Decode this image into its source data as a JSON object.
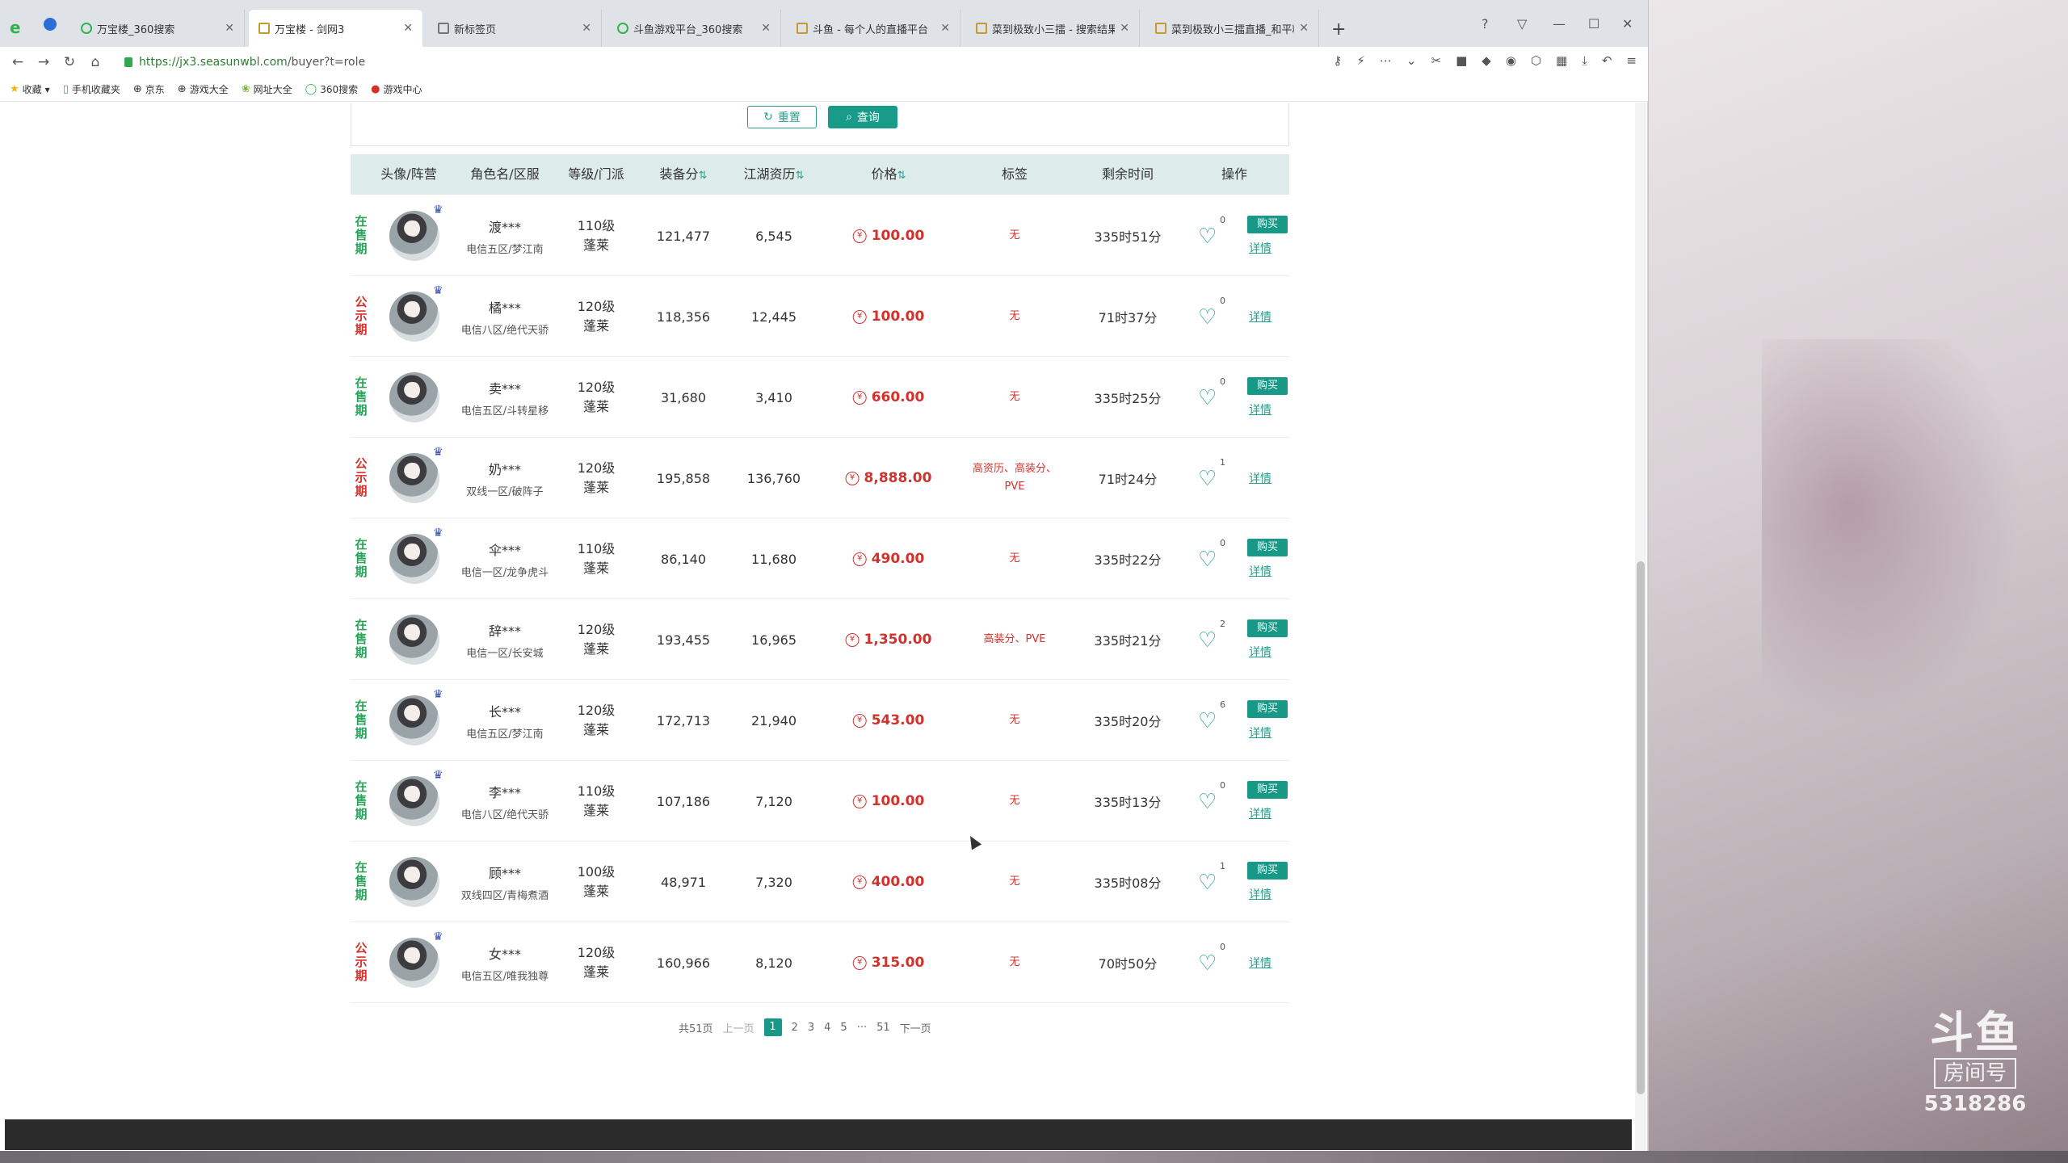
{
  "browser": {
    "tabs": [
      {
        "title": "万宝楼_360搜索"
      },
      {
        "title": "万宝楼 - 剑网3"
      },
      {
        "title": "新标签页"
      },
      {
        "title": "斗鱼游戏平台_360搜索"
      },
      {
        "title": "斗鱼 - 每个人的直播平台"
      },
      {
        "title": "菜到极致小三擂 - 搜索结果 -"
      },
      {
        "title": "菜到极致小三擂直播_和平精英"
      }
    ],
    "new_tab": "+",
    "url_host": "https://jx3.seasunwbl.com",
    "url_path": "/buyer?t=role",
    "bookmarks": [
      "收藏",
      "手机收藏夹",
      "京东",
      "游戏大全",
      "网址大全",
      "360搜索",
      "游戏中心"
    ]
  },
  "filter": {
    "reset_label": "重置",
    "query_label": "查询"
  },
  "table": {
    "headers": {
      "avatar": "头像/阵营",
      "role": "角色名/区服",
      "level": "等级/门派",
      "equip": "装备分",
      "jianghu": "江湖资历",
      "price": "价格",
      "tags": "标签",
      "remaining": "剩余时间",
      "action": "操作"
    },
    "sort_icon": "⇅",
    "buy_label": "购买",
    "detail_label": "详情",
    "coin_icon": "¥",
    "rows": [
      {
        "status": "在售期",
        "status_color": "#2aa35a",
        "badge": "♛",
        "name": "渡***",
        "server": "电信五区/梦江南",
        "level": "110级",
        "school": "蓬莱",
        "equip": "121,477",
        "jianghu": "6,545",
        "price": "100.00",
        "tags": "无",
        "remaining": "335时51分",
        "favs": "0",
        "buy": true
      },
      {
        "status": "公示期",
        "status_color": "#d3312c",
        "badge": "♛",
        "name": "橘***",
        "server": "电信八区/绝代天骄",
        "level": "120级",
        "school": "蓬莱",
        "equip": "118,356",
        "jianghu": "12,445",
        "price": "100.00",
        "tags": "无",
        "remaining": "71时37分",
        "favs": "0",
        "buy": false
      },
      {
        "status": "在售期",
        "status_color": "#2aa35a",
        "badge": "",
        "name": "卖***",
        "server": "电信五区/斗转星移",
        "level": "120级",
        "school": "蓬莱",
        "equip": "31,680",
        "jianghu": "3,410",
        "price": "660.00",
        "tags": "无",
        "remaining": "335时25分",
        "favs": "0",
        "buy": true
      },
      {
        "status": "公示期",
        "status_color": "#d3312c",
        "badge": "♛",
        "name": "奶***",
        "server": "双线一区/破阵子",
        "level": "120级",
        "school": "蓬莱",
        "equip": "195,858",
        "jianghu": "136,760",
        "price": "8,888.00",
        "tags": "高资历、高装分、PVE",
        "remaining": "71时24分",
        "favs": "1",
        "buy": false
      },
      {
        "status": "在售期",
        "status_color": "#2aa35a",
        "badge": "♛",
        "name": "伞***",
        "server": "电信一区/龙争虎斗",
        "level": "110级",
        "school": "蓬莱",
        "equip": "86,140",
        "jianghu": "11,680",
        "price": "490.00",
        "tags": "无",
        "remaining": "335时22分",
        "favs": "0",
        "buy": true
      },
      {
        "status": "在售期",
        "status_color": "#2aa35a",
        "badge": "",
        "name": "辞***",
        "server": "电信一区/长安城",
        "level": "120级",
        "school": "蓬莱",
        "equip": "193,455",
        "jianghu": "16,965",
        "price": "1,350.00",
        "tags": "高装分、PVE",
        "remaining": "335时21分",
        "favs": "2",
        "buy": true
      },
      {
        "status": "在售期",
        "status_color": "#2aa35a",
        "badge": "♛",
        "name": "长***",
        "server": "电信五区/梦江南",
        "level": "120级",
        "school": "蓬莱",
        "equip": "172,713",
        "jianghu": "21,940",
        "price": "543.00",
        "tags": "无",
        "remaining": "335时20分",
        "favs": "6",
        "buy": true
      },
      {
        "status": "在售期",
        "status_color": "#2aa35a",
        "badge": "♛",
        "name": "李***",
        "server": "电信八区/绝代天骄",
        "level": "110级",
        "school": "蓬莱",
        "equip": "107,186",
        "jianghu": "7,120",
        "price": "100.00",
        "tags": "无",
        "remaining": "335时13分",
        "favs": "0",
        "buy": true
      },
      {
        "status": "在售期",
        "status_color": "#2aa35a",
        "badge": "",
        "name": "顾***",
        "server": "双线四区/青梅煮酒",
        "level": "100级",
        "school": "蓬莱",
        "equip": "48,971",
        "jianghu": "7,320",
        "price": "400.00",
        "tags": "无",
        "remaining": "335时08分",
        "favs": "1",
        "buy": true
      },
      {
        "status": "公示期",
        "status_color": "#d3312c",
        "badge": "♛",
        "name": "女***",
        "server": "电信五区/唯我独尊",
        "level": "120级",
        "school": "蓬莱",
        "equip": "160,966",
        "jianghu": "8,120",
        "price": "315.00",
        "tags": "无",
        "remaining": "70时50分",
        "favs": "0",
        "buy": false
      }
    ]
  },
  "pagination": {
    "total": "共51页",
    "prev": "上一页",
    "pages": [
      "1",
      "2",
      "3",
      "4",
      "5"
    ],
    "ellipsis": "···",
    "last": "51",
    "next": "下一页",
    "current": "1"
  },
  "overlay": {
    "logo": "斗鱼",
    "room_label": "房间号",
    "room_number": "5318286"
  }
}
